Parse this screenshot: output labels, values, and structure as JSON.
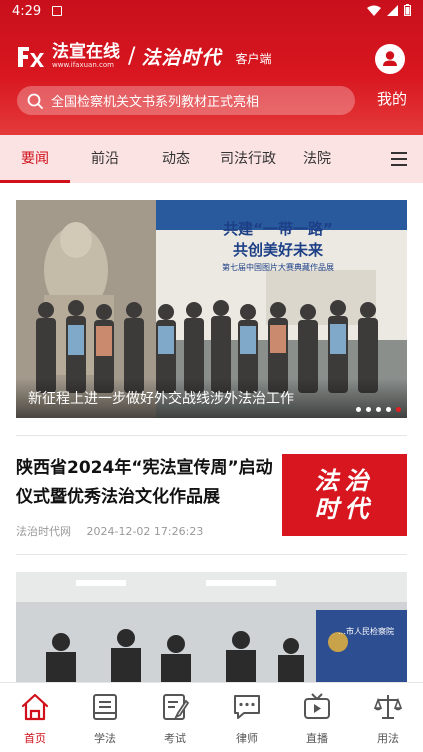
{
  "status_bar": {
    "time": "4:29"
  },
  "header": {
    "brand_name": "法宣在线",
    "brand_url": "www.ifaxuan.com",
    "brand_slash": "/",
    "brand_calligraphy": "法治时代",
    "brand_client": "客户端",
    "user_label": "我的"
  },
  "search": {
    "placeholder": "全国检察机关文书系列教材正式亮相"
  },
  "tabs": [
    {
      "label": "要闻",
      "active": true
    },
    {
      "label": "前沿"
    },
    {
      "label": "动态"
    },
    {
      "label": "司法行政"
    },
    {
      "label": "法院"
    }
  ],
  "banner": {
    "title": "新征程上进一步做好外交战线涉外法治工作",
    "slide_count": 5,
    "active_slide": 5,
    "photo_text": {
      "line1": "共建“一带一路”",
      "line2": "共创美好未来",
      "line3": "第七届中国图片大赛典藏作品展"
    }
  },
  "news": [
    {
      "title": "陕西省2024年“宪法宣传周”启动仪式暨优秀法治文化作品展",
      "source": "法治时代网",
      "datetime": "2024-12-02 17:26:23",
      "thumb_line1": "法治",
      "thumb_line2": "时代"
    }
  ],
  "photo2": {
    "sign_text": "…市人民检察院"
  },
  "bottom_nav": [
    {
      "label": "首页",
      "icon": "home-icon",
      "active": true
    },
    {
      "label": "学法",
      "icon": "book-icon"
    },
    {
      "label": "考试",
      "icon": "exam-icon"
    },
    {
      "label": "律师",
      "icon": "chat-icon"
    },
    {
      "label": "直播",
      "icon": "tv-icon"
    },
    {
      "label": "用法",
      "icon": "scales-icon"
    }
  ],
  "colors": {
    "brand_red": "#d0111b",
    "tab_bg": "#fbe3e3",
    "meta_gray": "#999999"
  }
}
